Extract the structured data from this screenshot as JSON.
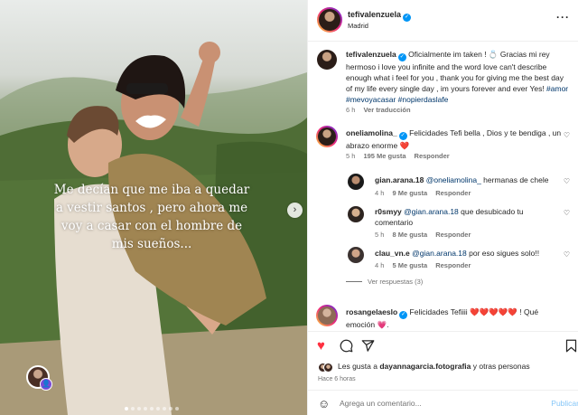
{
  "photo": {
    "overlay_text": "Me decían que me iba a quedar a vestir santos , pero ahora me voy a casar con el hombre de mis sueños...",
    "next_icon": "chevron-right-icon",
    "dots_count": 9,
    "active_dot": 1,
    "tag_icon": "tagged-person-icon"
  },
  "header": {
    "username": "tefivalenzuela",
    "location": "Madrid",
    "more_icon": "more-options-icon"
  },
  "caption": {
    "username": "tefivalenzuela",
    "text": "Oficialmente im taken ! 💍 Gracias mi rey hermoso i love you infinite and the word love can't describe enough what i feel for you , thank you for giving me the best day of my life every single day , im yours forever and ever Yes! ",
    "hashtags": "#amor #mevoyacasar #nopierdaslafe",
    "time": "6 h",
    "translate": "Ver traducción"
  },
  "comments": [
    {
      "username": "oneliamolina_",
      "text": "Felicidades Tefi bella , Dios y te bendiga , un abrazo enorme ❤️",
      "time": "5 h",
      "likes": "195 Me gusta",
      "reply": "Responder",
      "replies": [
        {
          "username": "gian.arana.18",
          "mention": "@oneliamolina_",
          "text": " hermanas de chele",
          "time": "4 h",
          "likes": "9 Me gusta",
          "reply": "Responder"
        },
        {
          "username": "r0smyy",
          "mention": "@gian.arana.18",
          "text": " que desubicado tu comentario",
          "time": "5 h",
          "likes": "8 Me gusta",
          "reply": "Responder"
        },
        {
          "username": "clau_vn.e",
          "mention": "@gian.arana.18",
          "text": " por eso sigues solo!!",
          "time": "4 h",
          "likes": "5 Me gusta",
          "reply": "Responder"
        }
      ],
      "view_replies": "Ver respuestas (3)"
    },
    {
      "username": "rosangelaeslo",
      "text": "Felicidades Tefiiii ❤️❤️❤️❤️❤️ ! Qué emoción 💗."
    }
  ],
  "actions": {
    "like_icon": "heart-filled-icon",
    "comment_icon": "comment-icon",
    "share_icon": "share-icon",
    "save_icon": "bookmark-icon",
    "likes_text_prefix": "Les gusta a ",
    "likes_user": "dayannagarcia.fotografia",
    "likes_suffix": " y otras personas",
    "posted_ago": "Hace 6 horas",
    "comment_placeholder": "Agrega un comentario...",
    "publish_label": "Publicar",
    "emoji_icon": "emoji-icon"
  },
  "colors": {
    "accent_blue": "#0095f6",
    "link_blue": "#00376b",
    "like_red": "#ff3040",
    "muted": "#737373"
  }
}
